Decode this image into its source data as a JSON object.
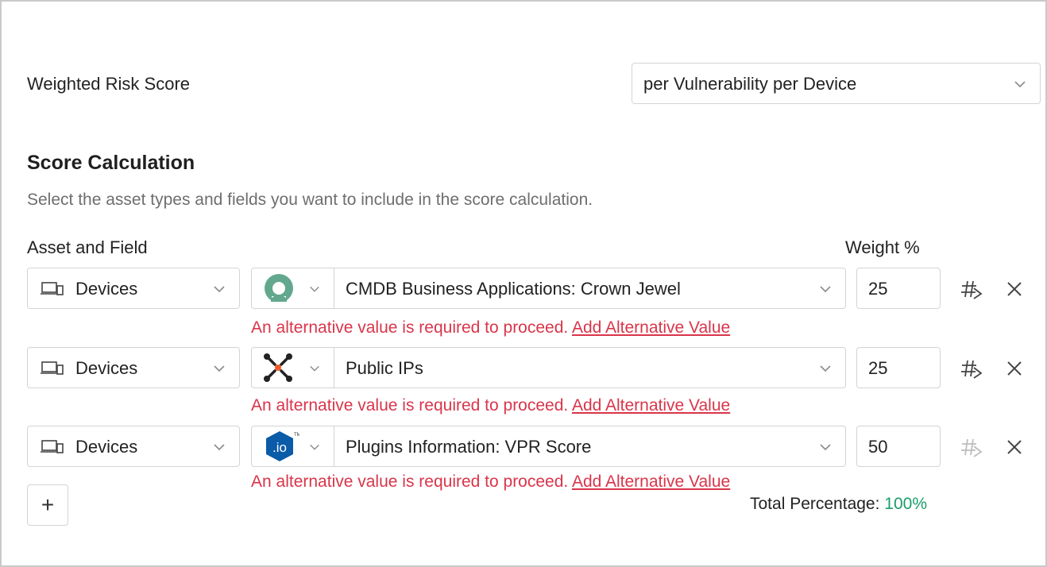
{
  "weighted_risk": {
    "label": "Weighted Risk Score",
    "select_value": "per Vulnerability per Device"
  },
  "score_calc": {
    "title": "Score Calculation",
    "description": "Select the asset types and fields you want to include in the score calculation.",
    "col_asset": "Asset and Field",
    "col_weight": "Weight %"
  },
  "rows": [
    {
      "asset": "Devices",
      "source_icon": "servicenow-icon",
      "field": "CMDB Business Applications: Crown Jewel",
      "weight": "25",
      "error_text": "An alternative value is required to proceed.",
      "error_link": "Add Alternative Value"
    },
    {
      "asset": "Devices",
      "source_icon": "network-node-icon",
      "field": "Public IPs",
      "weight": "25",
      "error_text": "An alternative value is required to proceed.",
      "error_link": "Add Alternative Value"
    },
    {
      "asset": "Devices",
      "source_icon": "tenable-io-icon",
      "source_badge": ".io",
      "field": "Plugins Information: VPR Score",
      "weight": "50",
      "error_text": "An alternative value is required to proceed.",
      "error_link": "Add Alternative Value"
    }
  ],
  "add_button": "+",
  "total": {
    "label": "Total Percentage:",
    "value": "100%"
  },
  "colors": {
    "error": "#d9354a",
    "total_value": "#1a9e6a",
    "servicenow": "#62a88e",
    "node_center": "#f05a28",
    "tenable_io": "#0a5ba8"
  }
}
